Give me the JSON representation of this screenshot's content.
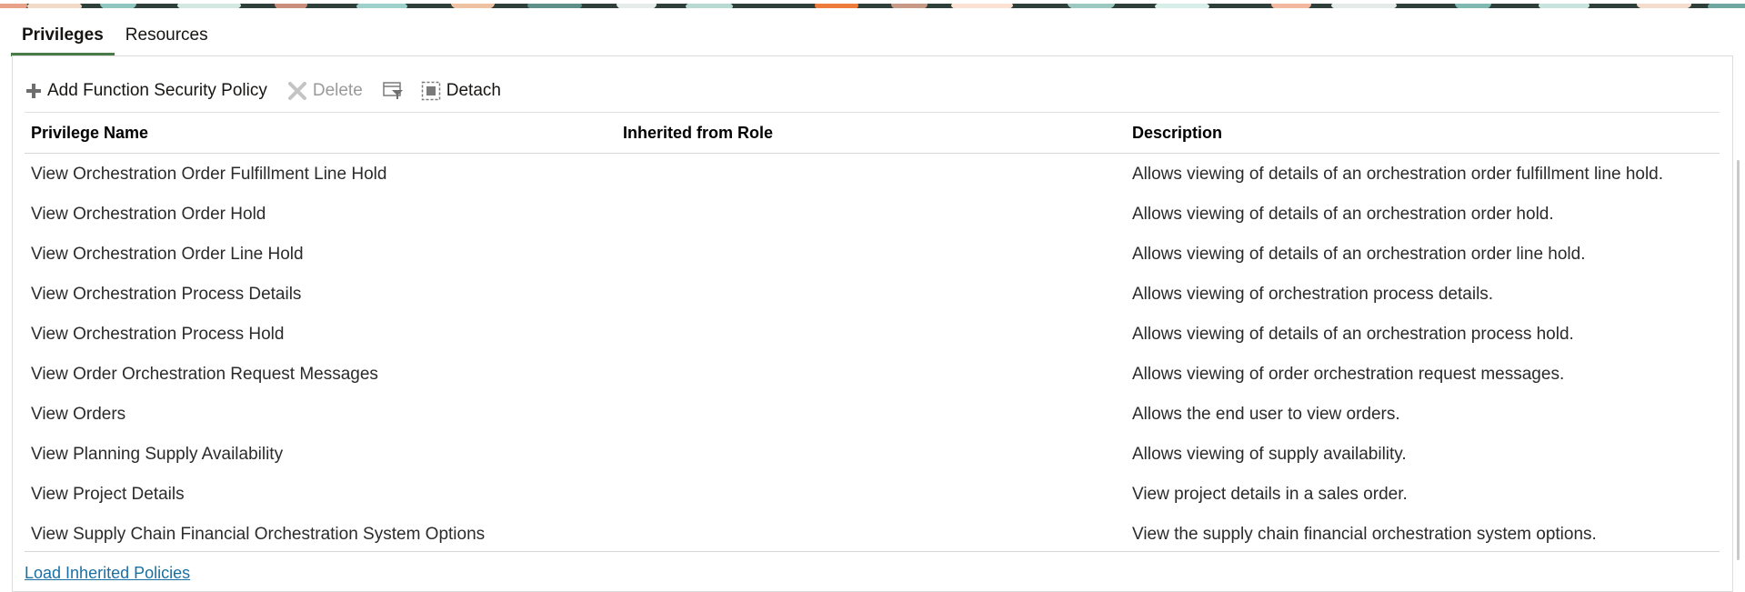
{
  "tabs": [
    {
      "label": "Privileges",
      "active": true
    },
    {
      "label": "Resources",
      "active": false
    }
  ],
  "toolbar": {
    "add_label": "Add Function Security Policy",
    "delete_label": "Delete",
    "detach_label": "Detach"
  },
  "table": {
    "headers": [
      "Privilege Name",
      "Inherited from Role",
      "Description"
    ],
    "rows": [
      {
        "name": "View Orchestration Order Fulfillment Line Hold",
        "role": "",
        "description": "Allows viewing of details of an orchestration order fulfillment line hold."
      },
      {
        "name": "View Orchestration Order Hold",
        "role": "",
        "description": "Allows viewing of details of an orchestration order hold."
      },
      {
        "name": "View Orchestration Order Line Hold",
        "role": "",
        "description": "Allows viewing of details of an orchestration order line hold."
      },
      {
        "name": "View Orchestration Process Details",
        "role": "",
        "description": "Allows viewing of orchestration process details."
      },
      {
        "name": "View Orchestration Process Hold",
        "role": "",
        "description": "Allows viewing of details of an orchestration process hold."
      },
      {
        "name": "View Order Orchestration Request Messages",
        "role": "",
        "description": "Allows viewing of order orchestration request messages."
      },
      {
        "name": "View Orders",
        "role": "",
        "description": "Allows the end user to view orders."
      },
      {
        "name": "View Planning Supply Availability",
        "role": "",
        "description": "Allows viewing of supply availability."
      },
      {
        "name": "View Project Details",
        "role": "",
        "description": "View project details in a sales order."
      },
      {
        "name": "View Supply Chain Financial Orchestration System Options",
        "role": "",
        "description": "View the supply chain financial orchestration system options."
      }
    ]
  },
  "footer": {
    "link_label": "Load Inherited Policies"
  },
  "colors": {
    "active_tab_underline": "#4a7c4a",
    "link": "#1a6fa3",
    "disabled": "#9a9a9a"
  }
}
